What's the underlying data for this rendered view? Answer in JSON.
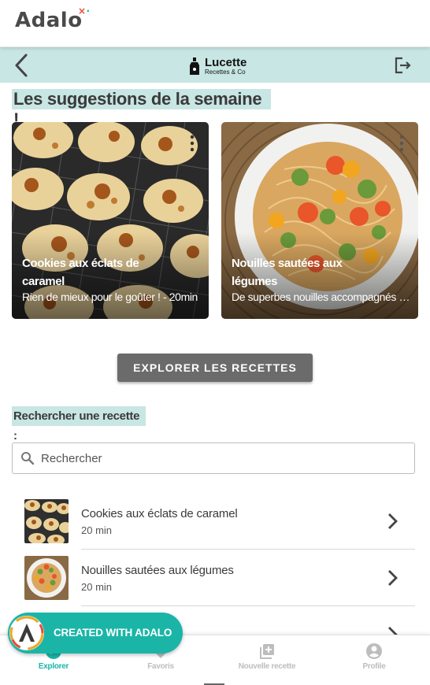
{
  "brand": {
    "name": "Adalo"
  },
  "header": {
    "logo_name": "Lucette",
    "logo_tagline": "Recettes & Co",
    "back_icon": "chevron-left-icon",
    "logout_icon": "logout-icon"
  },
  "suggestions": {
    "title": "Les suggestions de la semaine !",
    "cards": [
      {
        "title": "Cookies aux éclats de caramel",
        "subtitle": "Rien de mieux pour le goûter ! - 20min"
      },
      {
        "title": "Nouilles sautées aux légumes",
        "subtitle": "De superbes nouilles accompagnés de légumes"
      }
    ]
  },
  "explore_button": {
    "label": "EXPLORER LES RECETTES"
  },
  "search": {
    "label": "Rechercher une recette :",
    "placeholder": "Rechercher"
  },
  "recipes": [
    {
      "title": "Cookies aux éclats de caramel",
      "time": "20 min"
    },
    {
      "title": "Nouilles sautées aux légumes",
      "time": "20 min"
    }
  ],
  "bottom_nav": [
    {
      "label": "Explorer",
      "icon": "explore-icon",
      "active": true
    },
    {
      "label": "Favoris",
      "icon": "heart-icon",
      "active": false
    },
    {
      "label": "Nouvelle recette",
      "icon": "add-library-icon",
      "active": false
    },
    {
      "label": "Profile",
      "icon": "account-circle-icon",
      "active": false
    }
  ],
  "badge": {
    "text": "CREATED WITH ADALO"
  },
  "colors": {
    "accent": "#1bb5a8",
    "header_bg": "#c8e6e3",
    "button_bg": "#6b6b6b",
    "inactive_nav": "#bdbdbd"
  }
}
